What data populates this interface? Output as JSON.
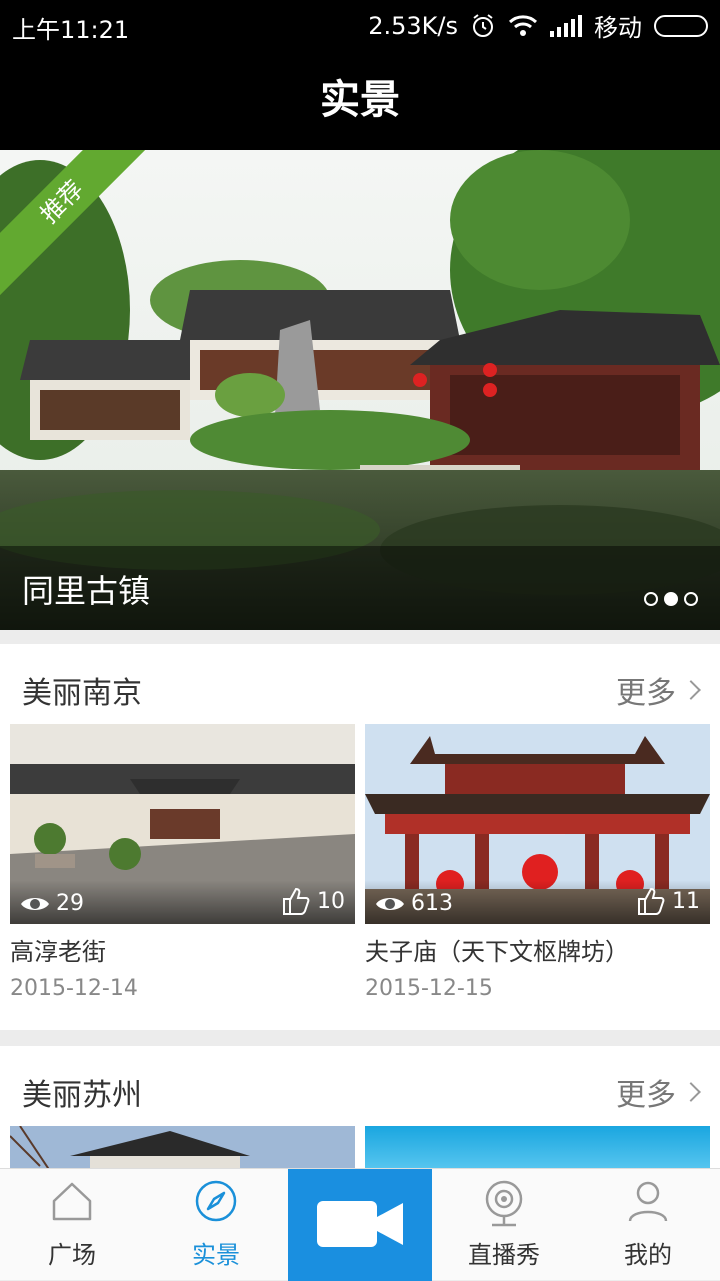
{
  "status": {
    "time": "上午11:21",
    "speed": "2.53K/s",
    "carrier": "移动"
  },
  "header": {
    "title": "实景"
  },
  "banner": {
    "badge": "推荐",
    "title": "同里古镇",
    "pages": 3,
    "active_page": 2
  },
  "sections": [
    {
      "title": "美丽南京",
      "more": "更多",
      "cards": [
        {
          "views": "29",
          "likes": "10",
          "title": "高淳老街",
          "date": "2015-12-14"
        },
        {
          "views": "613",
          "likes": "11",
          "title": "夫子庙（天下文枢牌坊）",
          "date": "2015-12-15"
        }
      ]
    },
    {
      "title": "美丽苏州",
      "more": "更多"
    }
  ],
  "tabs": [
    {
      "label": "广场",
      "icon": "home-icon"
    },
    {
      "label": "实景",
      "icon": "compass-icon"
    },
    {
      "label": "",
      "icon": "video-camera-icon"
    },
    {
      "label": "直播秀",
      "icon": "webcam-icon"
    },
    {
      "label": "我的",
      "icon": "person-icon"
    }
  ],
  "colors": {
    "accent": "#1a8fe0",
    "badge": "#62a930"
  }
}
